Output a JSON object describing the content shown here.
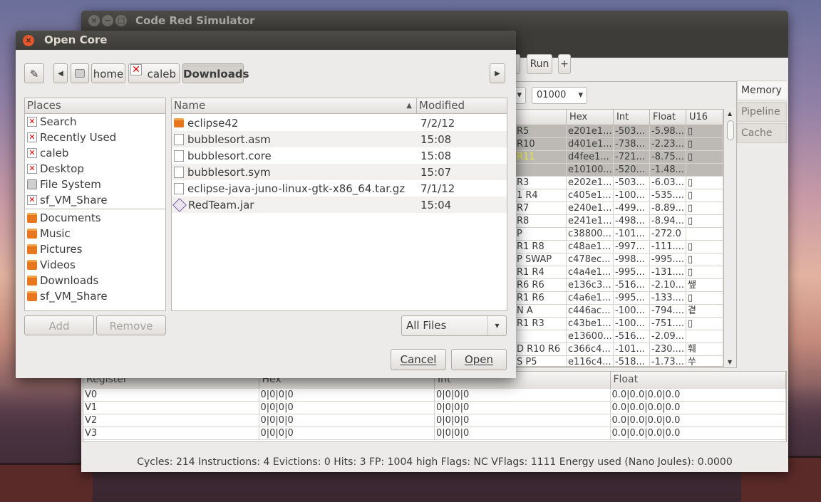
{
  "main_window": {
    "title": "Code Red Simulator",
    "toolbar": {
      "prev_label": "n",
      "run_label": "Run",
      "plus_label": "+"
    },
    "address_value": "01000",
    "tabs": [
      "Memory",
      "Pipeline",
      "Cache"
    ],
    "memory_table": {
      "headers": [
        "",
        "Hex",
        "Int",
        "Float",
        "U16"
      ],
      "rows": [
        [
          "R5",
          "e201e1...",
          "-503...",
          "-5.98...",
          "▯"
        ],
        [
          "R10",
          "d401e1...",
          "-738...",
          "-2.23...",
          "▯"
        ],
        [
          "R11",
          "d4fee1...",
          "-721...",
          "-8.75...",
          "▯"
        ],
        [
          "",
          "e10100...",
          "-520...",
          "-1.48...",
          ""
        ],
        [
          "R3",
          "e202e1...",
          "-503...",
          "-6.03...",
          "▯"
        ],
        [
          "1 R4",
          "c405e1...",
          "-100...",
          "-535....",
          "▯"
        ],
        [
          "R7",
          "e240e1...",
          "-499...",
          "-8.89...",
          "▯"
        ],
        [
          "R8",
          "e241e1...",
          "-498...",
          "-8.94...",
          "▯"
        ],
        [
          "P",
          "c38800...",
          "-101...",
          "-272.0",
          ""
        ],
        [
          "R1 R8",
          "c48ae1...",
          "-997...",
          "-111....",
          "▯"
        ],
        [
          "P SWAP",
          "c478ec...",
          "-998...",
          "-995....",
          "▯"
        ],
        [
          "R1 R4",
          "c4a4e1...",
          "-995...",
          "-131....",
          "▯"
        ],
        [
          "R6 R6",
          "e136c3...",
          "-516...",
          "-2.10...",
          "쌮"
        ],
        [
          "R1 R6",
          "c4a6e1...",
          "-995...",
          "-133....",
          "▯"
        ],
        [
          "N A",
          "c446ac...",
          "-100...",
          "-794....",
          "곁"
        ],
        [
          "R1 R3",
          "c43be1...",
          "-100...",
          "-751....",
          "▯"
        ],
        [
          "",
          "e13600...",
          "-516...",
          "-2.09...",
          ""
        ],
        [
          "D R10 R6",
          "c366c4...",
          "-101...",
          "-230....",
          "훼"
        ],
        [
          "S P5",
          "e116c4...",
          "-518...",
          "-1.73...",
          "쑤"
        ]
      ]
    },
    "register_table": {
      "headers": [
        "Register",
        "Hex",
        "Int",
        "Float"
      ],
      "rows": [
        [
          "V0",
          "0|0|0|0",
          "0|0|0|0",
          "0.0|0.0|0.0|0.0"
        ],
        [
          "V1",
          "0|0|0|0",
          "0|0|0|0",
          "0.0|0.0|0.0|0.0"
        ],
        [
          "V2",
          "0|0|0|0",
          "0|0|0|0",
          "0.0|0.0|0.0|0.0"
        ],
        [
          "V3",
          "0|0|0|0",
          "0|0|0|0",
          "0.0|0.0|0.0|0.0"
        ]
      ]
    },
    "status": "Cycles: 214 Instructions: 4 Evictions: 0 Hits: 3 FP: 1004 high Flags: NC VFlags: 1111 Energy used (Nano Joules): 0.0000"
  },
  "dialog": {
    "title": "Open Core",
    "path": [
      "home",
      "caleb",
      "Downloads"
    ],
    "places_header": "Places",
    "places_system": [
      {
        "label": "Search",
        "icon": "missing-icon"
      },
      {
        "label": "Recently Used",
        "icon": "missing-icon"
      },
      {
        "label": "caleb",
        "icon": "missing-icon"
      },
      {
        "label": "Desktop",
        "icon": "missing-icon"
      },
      {
        "label": "File System",
        "icon": "drive-icon"
      },
      {
        "label": "sf_VM_Share",
        "icon": "missing-icon"
      }
    ],
    "places_bookmarks": [
      "Documents",
      "Music",
      "Pictures",
      "Videos",
      "Downloads",
      "sf_VM_Share"
    ],
    "add_label": "Add",
    "remove_label": "Remove",
    "file_headers": {
      "name": "Name",
      "modified": "Modified"
    },
    "files": [
      {
        "name": "eclipse42",
        "modified": "7/2/12",
        "icon": "folder-icon"
      },
      {
        "name": "bubblesort.asm",
        "modified": "15:08",
        "icon": "document-icon"
      },
      {
        "name": "bubblesort.core",
        "modified": "15:08",
        "icon": "document-icon"
      },
      {
        "name": "bubblesort.sym",
        "modified": "15:07",
        "icon": "document-icon"
      },
      {
        "name": "eclipse-java-juno-linux-gtk-x86_64.tar.gz",
        "modified": "7/1/12",
        "icon": "document-icon"
      },
      {
        "name": "RedTeam.jar",
        "modified": "15:04",
        "icon": "jar-icon"
      }
    ],
    "filter_value": "All Files",
    "cancel_label": "Cancel",
    "open_label": "Open"
  },
  "colors": {
    "titlebar": "#3d3c38",
    "selection": "#bdbab5",
    "close_button": "#e2572d",
    "folder": "#e8761e",
    "highlight_text": "#e8e84a"
  }
}
